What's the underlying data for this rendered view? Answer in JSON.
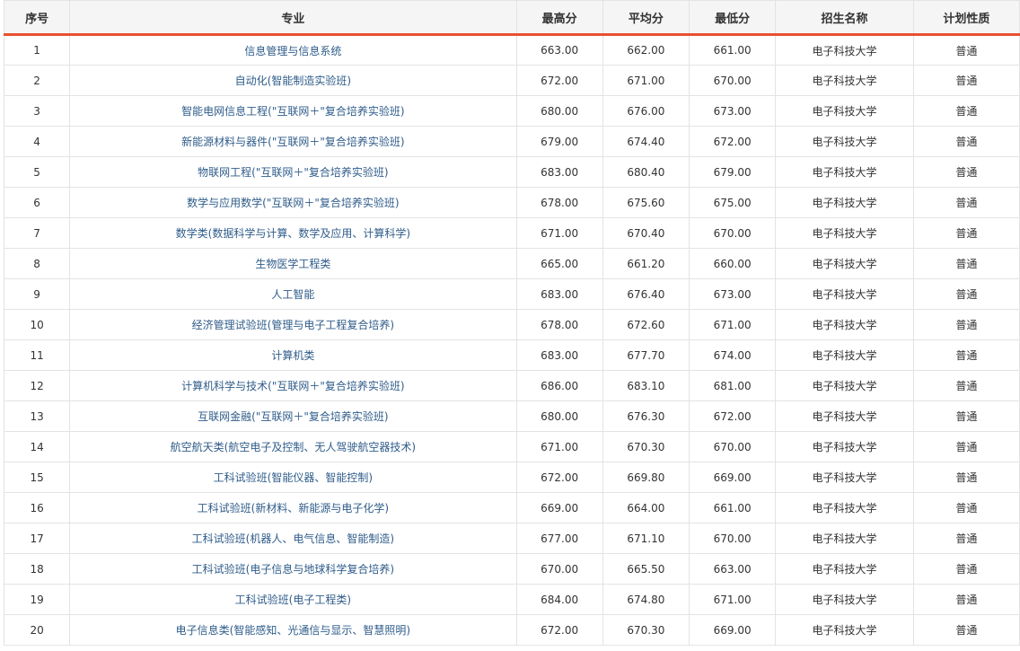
{
  "table": {
    "headers": {
      "index": "序号",
      "major": "专业",
      "max": "最高分",
      "avg": "平均分",
      "min": "最低分",
      "school": "招生名称",
      "type": "计划性质"
    },
    "rows": [
      {
        "index": "1",
        "major": "信息管理与信息系统",
        "max": "663.00",
        "avg": "662.00",
        "min": "661.00",
        "school": "电子科技大学",
        "type": "普通"
      },
      {
        "index": "2",
        "major": "自动化(智能制造实验班)",
        "max": "672.00",
        "avg": "671.00",
        "min": "670.00",
        "school": "电子科技大学",
        "type": "普通"
      },
      {
        "index": "3",
        "major": "智能电网信息工程(\"互联网＋\"复合培养实验班)",
        "max": "680.00",
        "avg": "676.00",
        "min": "673.00",
        "school": "电子科技大学",
        "type": "普通"
      },
      {
        "index": "4",
        "major": "新能源材料与器件(\"互联网＋\"复合培养实验班)",
        "max": "679.00",
        "avg": "674.40",
        "min": "672.00",
        "school": "电子科技大学",
        "type": "普通"
      },
      {
        "index": "5",
        "major": "物联网工程(\"互联网＋\"复合培养实验班)",
        "max": "683.00",
        "avg": "680.40",
        "min": "679.00",
        "school": "电子科技大学",
        "type": "普通"
      },
      {
        "index": "6",
        "major": "数学与应用数学(\"互联网＋\"复合培养实验班)",
        "max": "678.00",
        "avg": "675.60",
        "min": "675.00",
        "school": "电子科技大学",
        "type": "普通"
      },
      {
        "index": "7",
        "major": "数学类(数据科学与计算、数学及应用、计算科学)",
        "max": "671.00",
        "avg": "670.40",
        "min": "670.00",
        "school": "电子科技大学",
        "type": "普通"
      },
      {
        "index": "8",
        "major": "生物医学工程类",
        "max": "665.00",
        "avg": "661.20",
        "min": "660.00",
        "school": "电子科技大学",
        "type": "普通"
      },
      {
        "index": "9",
        "major": "人工智能",
        "max": "683.00",
        "avg": "676.40",
        "min": "673.00",
        "school": "电子科技大学",
        "type": "普通"
      },
      {
        "index": "10",
        "major": "经济管理试验班(管理与电子工程复合培养)",
        "max": "678.00",
        "avg": "672.60",
        "min": "671.00",
        "school": "电子科技大学",
        "type": "普通"
      },
      {
        "index": "11",
        "major": "计算机类",
        "max": "683.00",
        "avg": "677.70",
        "min": "674.00",
        "school": "电子科技大学",
        "type": "普通"
      },
      {
        "index": "12",
        "major": "计算机科学与技术(\"互联网＋\"复合培养实验班)",
        "max": "686.00",
        "avg": "683.10",
        "min": "681.00",
        "school": "电子科技大学",
        "type": "普通"
      },
      {
        "index": "13",
        "major": "互联网金融(\"互联网＋\"复合培养实验班)",
        "max": "680.00",
        "avg": "676.30",
        "min": "672.00",
        "school": "电子科技大学",
        "type": "普通"
      },
      {
        "index": "14",
        "major": "航空航天类(航空电子及控制、无人驾驶航空器技术)",
        "max": "671.00",
        "avg": "670.30",
        "min": "670.00",
        "school": "电子科技大学",
        "type": "普通"
      },
      {
        "index": "15",
        "major": "工科试验班(智能仪器、智能控制)",
        "max": "672.00",
        "avg": "669.80",
        "min": "669.00",
        "school": "电子科技大学",
        "type": "普通"
      },
      {
        "index": "16",
        "major": "工科试验班(新材料、新能源与电子化学)",
        "max": "669.00",
        "avg": "664.00",
        "min": "661.00",
        "school": "电子科技大学",
        "type": "普通"
      },
      {
        "index": "17",
        "major": "工科试验班(机器人、电气信息、智能制造)",
        "max": "677.00",
        "avg": "671.10",
        "min": "670.00",
        "school": "电子科技大学",
        "type": "普通"
      },
      {
        "index": "18",
        "major": "工科试验班(电子信息与地球科学复合培养)",
        "max": "670.00",
        "avg": "665.50",
        "min": "663.00",
        "school": "电子科技大学",
        "type": "普通"
      },
      {
        "index": "19",
        "major": "工科试验班(电子工程类)",
        "max": "684.00",
        "avg": "674.80",
        "min": "671.00",
        "school": "电子科技大学",
        "type": "普通"
      },
      {
        "index": "20",
        "major": "电子信息类(智能感知、光通信与显示、智慧照明)",
        "max": "672.00",
        "avg": "670.30",
        "min": "669.00",
        "school": "电子科技大学",
        "type": "普通"
      }
    ]
  },
  "colors": {
    "header_bg": "#f5f5f5",
    "header_accent": "#e8502f",
    "link": "#2f5c8a",
    "border": "#e3e3e3"
  }
}
